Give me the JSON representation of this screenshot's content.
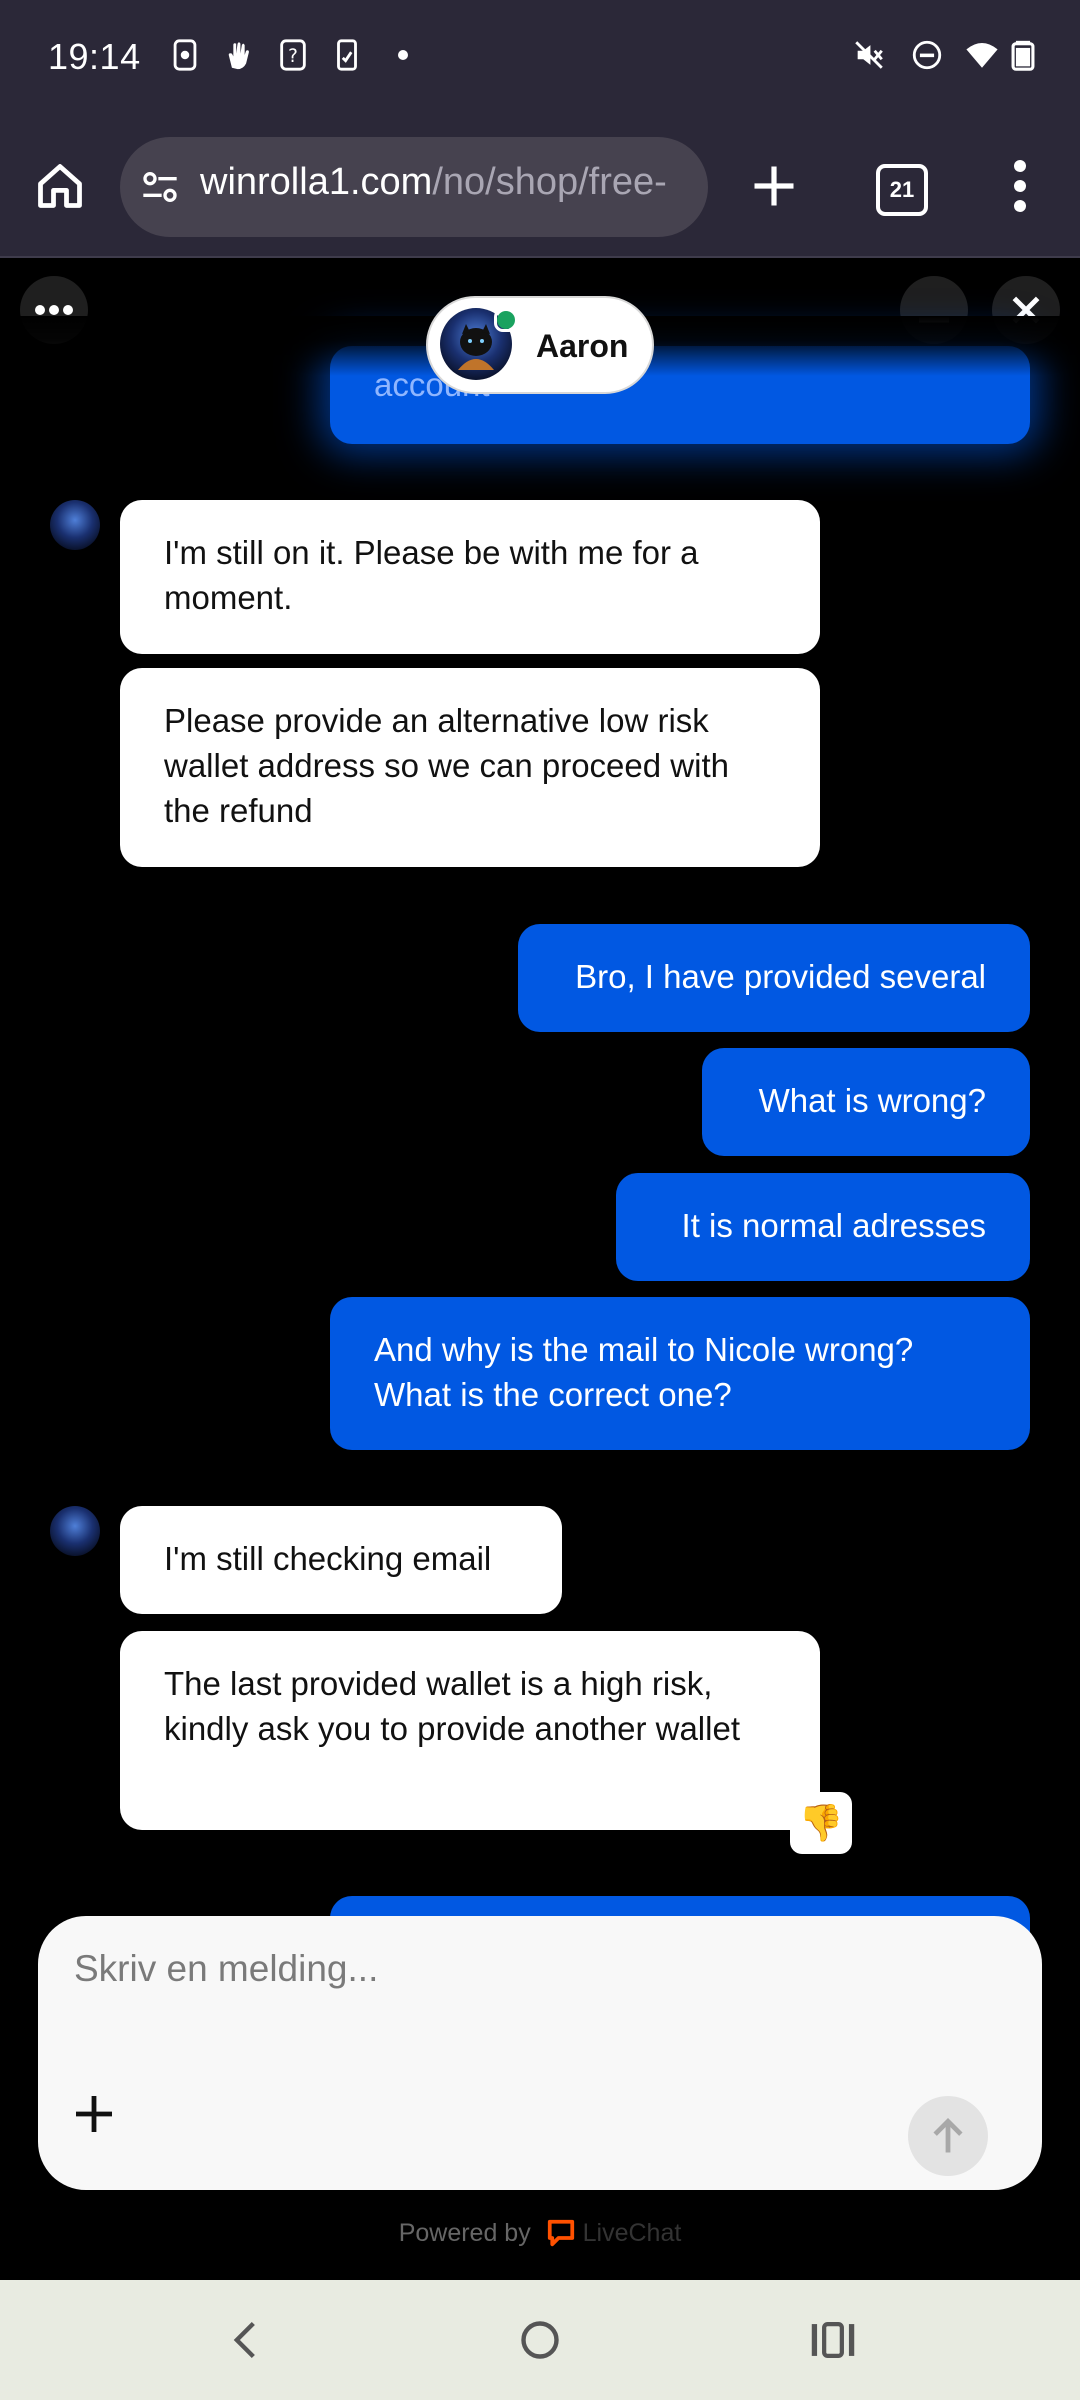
{
  "status_bar": {
    "time": "19:14",
    "left_icons": [
      "screen-record-icon",
      "hand-wave-icon",
      "help-box-icon",
      "phone-note-icon",
      "dot-icon"
    ],
    "right_icons": [
      "muted-icon",
      "do-not-disturb-icon",
      "wifi-icon",
      "battery-icon"
    ]
  },
  "browser": {
    "url_domain": "winrolla1.com",
    "url_path": "/no/shop/free-",
    "tab_count": "21"
  },
  "chat": {
    "agent_name": "Aaron",
    "agent_status_color": "#1aa25f",
    "partial_top_message": "account",
    "messages": [
      {
        "from": "agent",
        "text": "I'm still on it. Please be with me for a moment."
      },
      {
        "from": "agent",
        "text": "Please provide an alternative low risk wallet address so we can proceed with the refund"
      },
      {
        "from": "user",
        "text": "Bro, I have provided several"
      },
      {
        "from": "user",
        "text": "What is wrong?"
      },
      {
        "from": "user",
        "text": "It is normal adresses"
      },
      {
        "from": "user",
        "text": "And why is the mail to Nicole wrong? What is the correct one?"
      },
      {
        "from": "agent",
        "text": "I'm still checking email"
      },
      {
        "from": "agent",
        "text": "The last provided wallet is a high risk, kindly ask you to provide another wallet",
        "reaction": "👎"
      }
    ],
    "composer_placeholder": "Skriv en melding...",
    "powered_by": "Powered by",
    "brand": "LiveChat",
    "colors": {
      "user_bubble": "#0158e2",
      "agent_bubble": "#ffffff",
      "background": "#000000",
      "brand": "#ff5100"
    }
  }
}
